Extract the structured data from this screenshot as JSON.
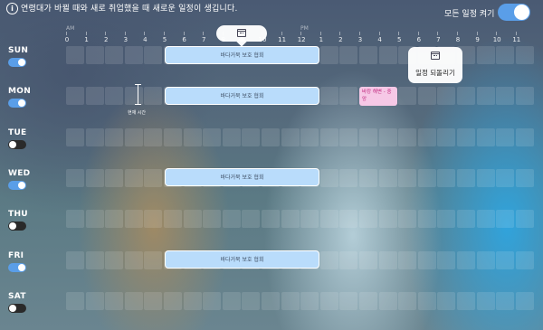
{
  "header": {
    "info_icon": "i",
    "info_text": "연령대가 바뀔 때와 새로 취업했을 때 새로운 일정이 생깁니다.",
    "all_schedule_label": "모든 일정 켜기",
    "all_schedule_on": true
  },
  "timeline": {
    "am": "AM",
    "pm": "PM",
    "hours": [
      "0",
      "1",
      "2",
      "3",
      "4",
      "5",
      "6",
      "7",
      "8",
      "9",
      "10",
      "11",
      "12",
      "1",
      "2",
      "3",
      "4",
      "5",
      "6",
      "7",
      "8",
      "9",
      "10",
      "11"
    ]
  },
  "days": [
    {
      "label": "SUN",
      "on": true
    },
    {
      "label": "MON",
      "on": true
    },
    {
      "label": "TUE",
      "on": false
    },
    {
      "label": "WED",
      "on": true
    },
    {
      "label": "THU",
      "on": false
    },
    {
      "label": "FRI",
      "on": true
    },
    {
      "label": "SAT",
      "on": false
    }
  ],
  "events": {
    "main_label": "바다거북 보호 협회",
    "pink_label": "바캉 해변 - 중앙"
  },
  "now_marker": {
    "label": "현재 시간"
  },
  "popup": {
    "label": "일정 되돌리기",
    "icon": "calendar-icon"
  },
  "colors": {
    "toggle_on": "#5a9ee8",
    "event_blue": "#b9dcfb",
    "event_pink": "#f6c8e6"
  }
}
